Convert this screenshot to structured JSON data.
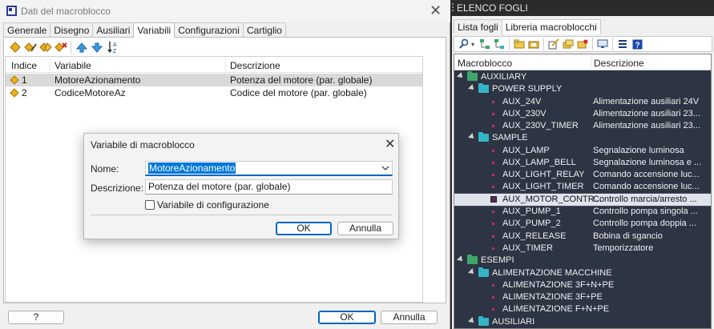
{
  "left_dialog": {
    "title": "Dati del macroblocco",
    "tabs": [
      "Generale",
      "Disegno",
      "Ausiliari",
      "Variabili",
      "Configurazioni",
      "Cartiglio"
    ],
    "active_tab": "Variabili",
    "table": {
      "headers": {
        "index": "Indice",
        "variable": "Variabile",
        "description": "Descrizione"
      },
      "rows": [
        {
          "index": "1",
          "variable": "MotoreAzionamento",
          "description": "Potenza del motore (par. globale)"
        },
        {
          "index": "2",
          "variable": "CodiceMotoreAz",
          "description": "Codice del motore (par. globale)"
        }
      ]
    },
    "buttons": {
      "help": "?",
      "ok": "OK",
      "cancel": "Annulla"
    }
  },
  "modal": {
    "title": "Variabile di macroblocco",
    "name_label": "Nome:",
    "name_value": "MotoreAzionamento",
    "description_label": "Descrizione:",
    "description_value": "Potenza del motore (par. globale)",
    "config_checkbox_label": "Variabile di configurazione",
    "config_checked": false,
    "ok": "OK",
    "cancel": "Annulla"
  },
  "right_panel": {
    "title": "ELENCO FOGLI",
    "tabs": [
      "Lista fogli",
      "Libreria macroblocchi"
    ],
    "active_tab": "Libreria macroblocchi",
    "headers": {
      "macro": "Macroblocco",
      "description": "Descrizione"
    },
    "tree": [
      {
        "label": "AUXILIARY",
        "desc": ""
      },
      {
        "label": "POWER SUPPLY",
        "desc": ""
      },
      {
        "label": "AUX_24V",
        "desc": "Alimentazione ausiliari 24V"
      },
      {
        "label": "AUX_230V",
        "desc": "Alimentazione ausiliari 23..."
      },
      {
        "label": "AUX_230V_TIMER",
        "desc": "Alimentazione ausiliari 23..."
      },
      {
        "label": "SAMPLE",
        "desc": ""
      },
      {
        "label": "AUX_LAMP",
        "desc": "Segnalazione luminosa"
      },
      {
        "label": "AUX_LAMP_BELL",
        "desc": "Segnalazione luminosa e ..."
      },
      {
        "label": "AUX_LIGHT_RELAY",
        "desc": "Comando accensione luc..."
      },
      {
        "label": "AUX_LIGHT_TIMER",
        "desc": "Comando accensione luc..."
      },
      {
        "label": "AUX_MOTOR_CONTR...",
        "desc": "Controllo marcia/arresto ..."
      },
      {
        "label": "AUX_PUMP_1",
        "desc": "Controllo pompa singola ..."
      },
      {
        "label": "AUX_PUMP_2",
        "desc": "Controllo pompa doppia ..."
      },
      {
        "label": "AUX_RELEASE",
        "desc": "Bobina di sgancio"
      },
      {
        "label": "AUX_TIMER",
        "desc": "Temporizzatore"
      },
      {
        "label": "ESEMPI",
        "desc": ""
      },
      {
        "label": "ALIMENTAZIONE MACCHINE",
        "desc": ""
      },
      {
        "label": "ALIMENTAZIONE 3F+N+PE",
        "desc": ""
      },
      {
        "label": "ALIMENTAZIONE 3F+PE",
        "desc": ""
      },
      {
        "label": "ALIMENTAZIONE F+N+PE",
        "desc": ""
      },
      {
        "label": "AUSILIARI",
        "desc": ""
      }
    ]
  }
}
